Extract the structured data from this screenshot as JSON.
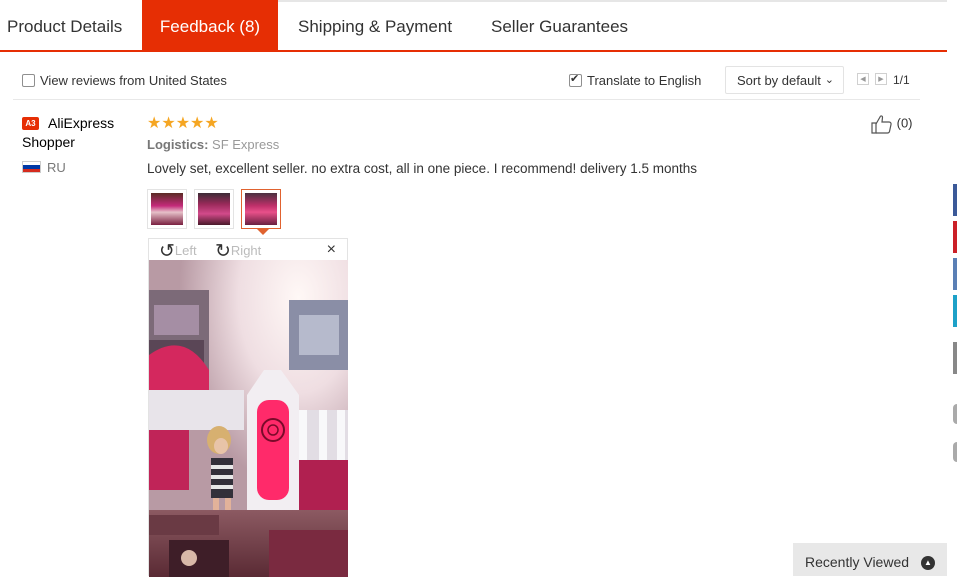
{
  "tabs": {
    "product_details": "Product Details",
    "feedback": "Feedback (8)",
    "shipping": "Shipping & Payment",
    "guarantees": "Seller Guarantees"
  },
  "filters": {
    "view_us": "View reviews from United States",
    "view_us_checked": false,
    "translate": "Translate to English",
    "translate_checked": true,
    "sort": "Sort by default",
    "page": "1/1"
  },
  "review": {
    "level_badge": "A3",
    "user_name": "AliExpress Shopper",
    "country": "RU",
    "stars": "★★★★★",
    "rating": 5,
    "logistics_label": "Logistics:",
    "logistics_value": "SF Express",
    "text": "Lovely set, excellent seller. no extra cost, all in one piece. I recommend! delivery 1.5 months",
    "helpful_count": "(0)",
    "photo_count": 3,
    "active_photo": 3
  },
  "viewer": {
    "rotate_left": "Left",
    "rotate_right": "Right",
    "close": "×"
  },
  "recently_viewed": "Recently Viewed",
  "colors": {
    "accent": "#e62e04",
    "star": "#f5a623"
  },
  "icons": [
    "thumbs-up-icon",
    "rotate-left-icon",
    "rotate-right-icon",
    "close-icon",
    "chevron-up-icon",
    "russia-flag-icon"
  ]
}
